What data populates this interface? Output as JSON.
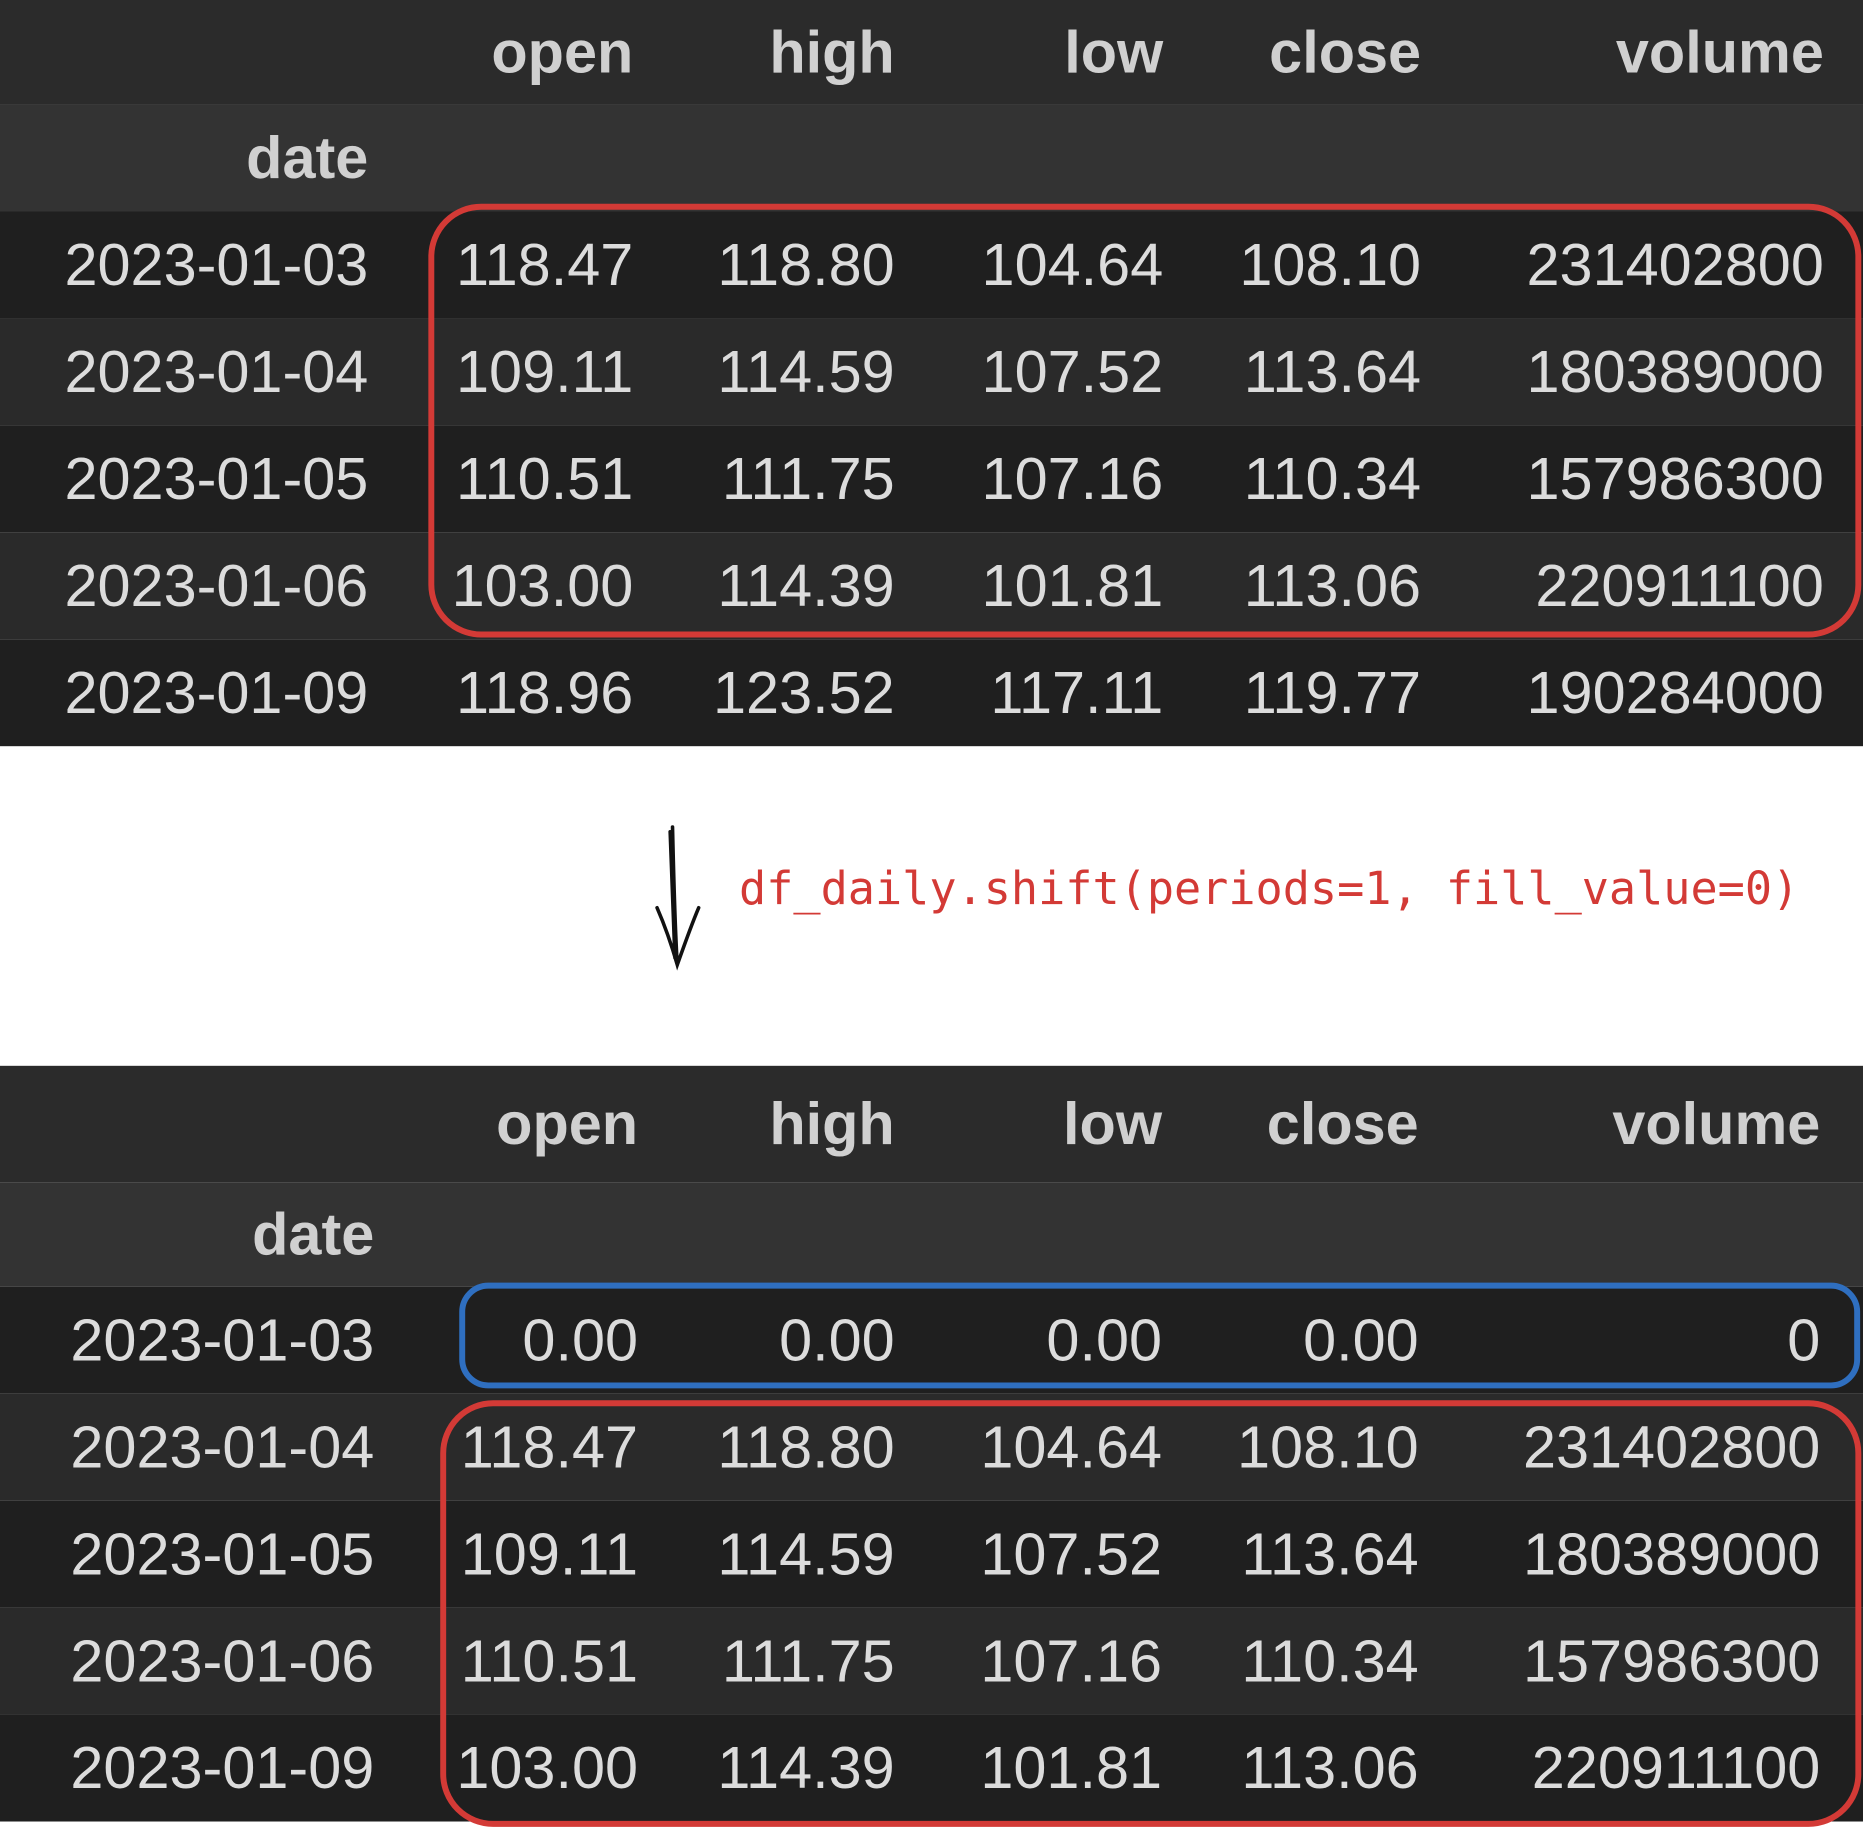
{
  "columns": [
    "open",
    "high",
    "low",
    "close",
    "volume"
  ],
  "index_name": "date",
  "before": {
    "rows": [
      {
        "date": "2023-01-03",
        "values": [
          "118.47",
          "118.80",
          "104.64",
          "108.10",
          "231402800"
        ]
      },
      {
        "date": "2023-01-04",
        "values": [
          "109.11",
          "114.59",
          "107.52",
          "113.64",
          "180389000"
        ]
      },
      {
        "date": "2023-01-05",
        "values": [
          "110.51",
          "111.75",
          "107.16",
          "110.34",
          "157986300"
        ]
      },
      {
        "date": "2023-01-06",
        "values": [
          "103.00",
          "114.39",
          "101.81",
          "113.06",
          "220911100"
        ]
      },
      {
        "date": "2023-01-09",
        "values": [
          "118.96",
          "123.52",
          "117.11",
          "119.77",
          "190284000"
        ]
      }
    ]
  },
  "operation": "df_daily.shift(periods=1, fill_value=0)",
  "after": {
    "rows": [
      {
        "date": "2023-01-03",
        "values": [
          "0.00",
          "0.00",
          "0.00",
          "0.00",
          "0"
        ]
      },
      {
        "date": "2023-01-04",
        "values": [
          "118.47",
          "118.80",
          "104.64",
          "108.10",
          "231402800"
        ]
      },
      {
        "date": "2023-01-05",
        "values": [
          "109.11",
          "114.59",
          "107.52",
          "113.64",
          "180389000"
        ]
      },
      {
        "date": "2023-01-06",
        "values": [
          "110.51",
          "111.75",
          "107.16",
          "110.34",
          "157986300"
        ]
      },
      {
        "date": "2023-01-09",
        "values": [
          "103.00",
          "114.39",
          "101.81",
          "113.06",
          "220911100"
        ]
      }
    ]
  },
  "colors": {
    "highlight_shifted": "#d33a36",
    "highlight_fill": "#2f6fc0",
    "code": "#d33a36"
  }
}
